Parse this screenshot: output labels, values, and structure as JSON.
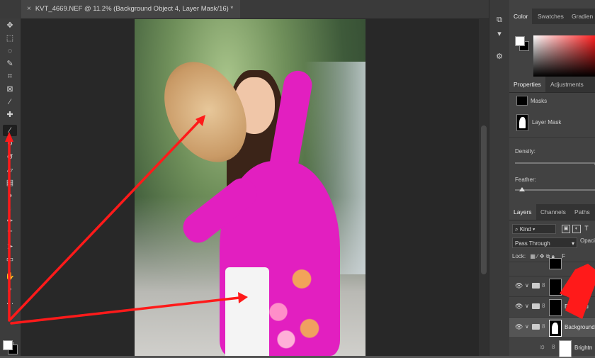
{
  "document_tab": {
    "close": "×",
    "title": "KVT_4669.NEF @ 11.2% (Background Object 4, Layer Mask/16) *"
  },
  "tools": [
    "move-tool",
    "marquee-tool",
    "lasso-tool",
    "quick-select-tool",
    "crop-tool",
    "frame-tool",
    "eyedropper-tool",
    "healing-brush-tool",
    "brush-tool",
    "clone-stamp-tool",
    "history-brush-tool",
    "eraser-tool",
    "gradient-tool",
    "blur-tool",
    "dodge-tool",
    "pen-tool",
    "type-tool",
    "path-select-tool",
    "shape-tool",
    "hand-tool",
    "zoom-tool"
  ],
  "color_panel": {
    "tabs": [
      "Color",
      "Swatches",
      "Gradien"
    ]
  },
  "properties_panel": {
    "tabs": [
      "Properties",
      "Adjustments"
    ],
    "masks_label": "Masks",
    "layer_mask_label": "Layer Mask",
    "density_label": "Density:",
    "feather_label": "Feather:"
  },
  "layers_panel": {
    "tabs": [
      "Layers",
      "Channels",
      "Paths"
    ],
    "kind_filter": "Kind",
    "blend_mode": "Pass Through",
    "opacity_label": "Opaci",
    "lock_label": "Lock:",
    "fill_label": "F",
    "layers": [
      {
        "name": "",
        "thumb": "black"
      },
      {
        "name": "ground",
        "thumb": "black"
      },
      {
        "name": "Backgrou",
        "thumb": "black"
      },
      {
        "name": "Background",
        "thumb": "black",
        "selected": true
      },
      {
        "name": "Brightn",
        "thumb": "white",
        "adjustment": true
      }
    ]
  },
  "colors": {
    "annotation_arrow": "#ff1a1a",
    "dress": "#e21fc0"
  }
}
